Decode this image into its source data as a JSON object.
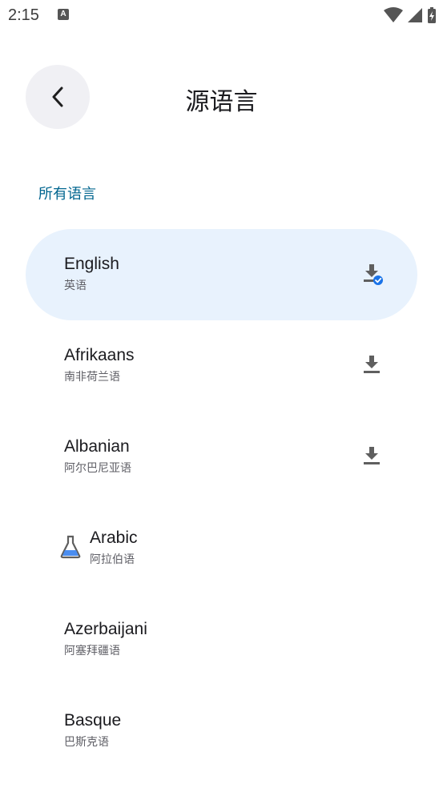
{
  "status_bar": {
    "time": "2:15",
    "notification_letter": "A"
  },
  "header": {
    "title": "源语言"
  },
  "section": {
    "label": "所有语言"
  },
  "languages": [
    {
      "name": "English",
      "native": "英语",
      "status": "downloaded",
      "selected": true
    },
    {
      "name": "Afrikaans",
      "native": "南非荷兰语",
      "status": "download"
    },
    {
      "name": "Albanian",
      "native": "阿尔巴尼亚语",
      "status": "download"
    },
    {
      "name": "Arabic",
      "native": "阿拉伯语",
      "status": "beta"
    },
    {
      "name": "Azerbaijani",
      "native": "阿塞拜疆语",
      "status": "none"
    },
    {
      "name": "Basque",
      "native": "巴斯克语",
      "status": "none"
    }
  ],
  "colors": {
    "accent": "#00658f",
    "selected_bg": "#e8f2fd",
    "check_blue": "#1a73e8",
    "beta_blue": "#4a8df0"
  }
}
